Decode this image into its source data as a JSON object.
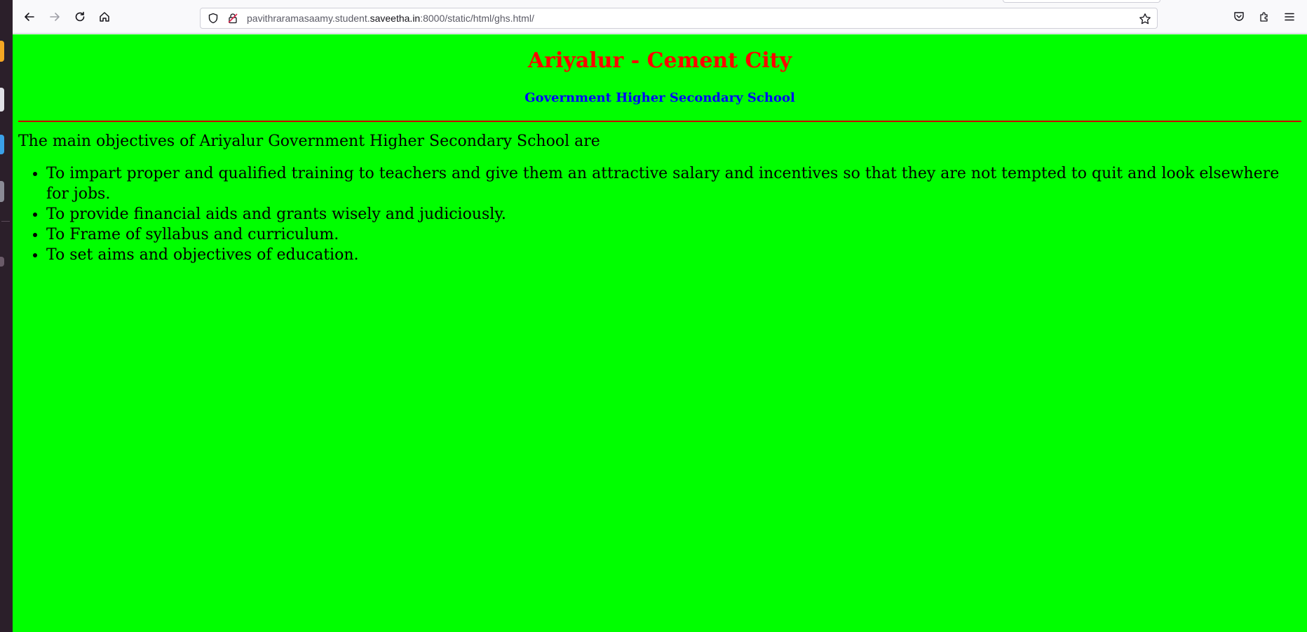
{
  "browser": {
    "url_prefix": "pavithraramasaamy.student.",
    "url_host": "saveetha.in",
    "url_suffix": ":8000/static/html/ghs.html/"
  },
  "page": {
    "title": "Ariyalur - Cement City",
    "subtitle": "Government Higher Secondary School",
    "intro": "The main objectives of Ariyalur Government Higher Secondary School are",
    "objectives": [
      "To impart proper and qualified training to teachers and give them an attractive salary and incentives so that they are not tempted to quit and look elsewhere for jobs.",
      "To provide financial aids and grants wisely and judiciously.",
      "To Frame of syllabus and curriculum.",
      "To set aims and objectives of education."
    ]
  },
  "colors": {
    "background": "#00ff00",
    "title": "#ff0000",
    "subtitle": "#0000ff",
    "rule": "#cc0000"
  },
  "icons": [
    "back-icon",
    "forward-icon",
    "reload-icon",
    "home-icon",
    "shield-icon",
    "lock-icon",
    "star-icon",
    "pocket-icon",
    "extensions-icon",
    "menu-icon"
  ]
}
